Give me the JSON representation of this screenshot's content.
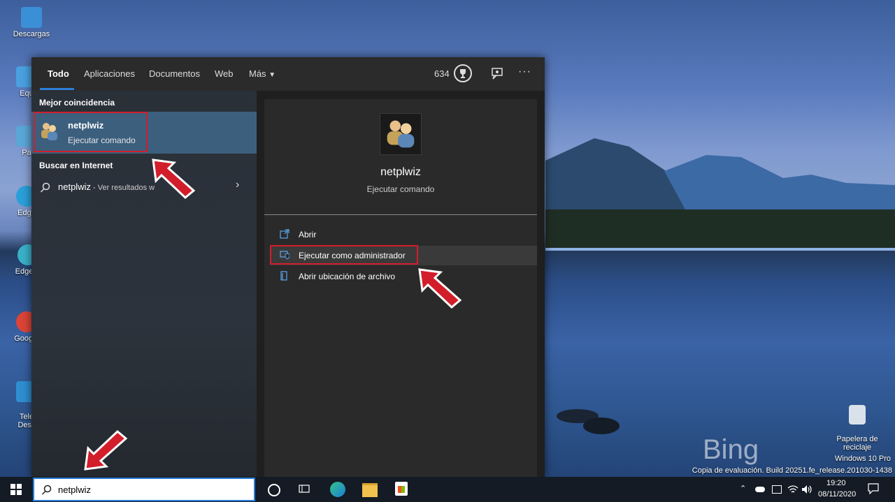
{
  "desktop": {
    "icons": [
      {
        "label": "Descargas"
      },
      {
        "label": "Equ"
      },
      {
        "label": "Pa"
      },
      {
        "label": "Edge"
      },
      {
        "label": "Edge C"
      },
      {
        "label": "Google"
      },
      {
        "label": "Tele\nDesk"
      }
    ],
    "recycle_bin_label": "Papelera de\nreciclaje",
    "bing_logo": "Bing",
    "watermark_edition": "Windows 10 Pro",
    "watermark_build": "Copia de evaluación. Build 20251.fe_release.201030-1438"
  },
  "search_panel": {
    "tabs": [
      {
        "label": "Todo",
        "active": true
      },
      {
        "label": "Aplicaciones"
      },
      {
        "label": "Documentos"
      },
      {
        "label": "Web"
      },
      {
        "label": "Más"
      }
    ],
    "points": "634",
    "best_match_title": "Mejor coincidencia",
    "best_match": {
      "name": "netplwiz",
      "type": "Ejecutar comando"
    },
    "web_section_title": "Buscar en Internet",
    "web_result": {
      "query": "netplwiz",
      "suffix": " - Ver resultados w"
    },
    "preview": {
      "name": "netplwiz",
      "type": "Ejecutar comando"
    },
    "actions": [
      {
        "label": "Abrir",
        "icon": "open-icon"
      },
      {
        "label": "Ejecutar como administrador",
        "icon": "shield-icon",
        "highlighted": true
      },
      {
        "label": "Abrir ubicación de archivo",
        "icon": "folder-icon"
      }
    ]
  },
  "taskbar": {
    "search_value": "netplwiz",
    "time": "19:20",
    "date": "08/11/2020"
  },
  "colors": {
    "accent": "#2b7fd9",
    "highlight_red": "#d21d2b",
    "best_match_bg": "#3c5f7e"
  }
}
